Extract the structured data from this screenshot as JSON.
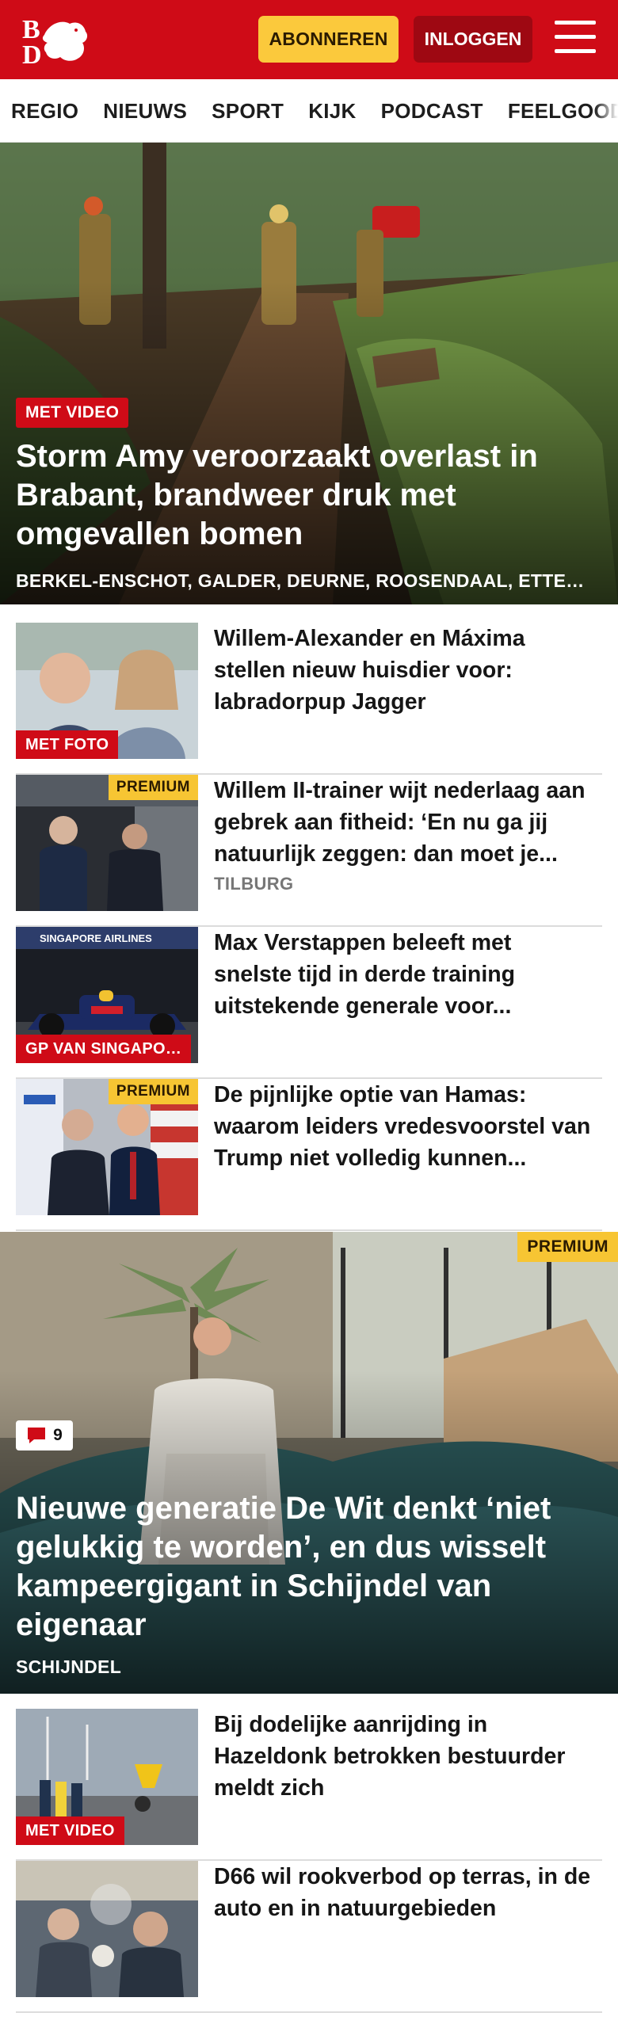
{
  "header": {
    "logo_text": "BD",
    "subscribe_label": "ABONNEREN",
    "login_label": "INLOGGEN",
    "brand_color": "#cf0b17"
  },
  "nav": {
    "items": [
      "REGIO",
      "NIEUWS",
      "SPORT",
      "KIJK",
      "PODCAST",
      "FEELGOOD"
    ]
  },
  "hero": {
    "label": "MET VIDEO",
    "title": "Storm Amy veroorzaakt overlast in Brabant, brandweer druk met omgevallen bomen",
    "places": "BERKEL-ENSCHOT, GALDER, DEURNE, ROOSENDAAL, ETTE…"
  },
  "articles_top": [
    {
      "title": "Willem-Alexander en Máxima stellen nieuw huisdier voor: labradorpup Jagger",
      "label": "MET FOTO",
      "premium": "",
      "place": ""
    },
    {
      "title": "Willem II-trainer wijt nederlaag aan gebrek aan fitheid: ‘En nu ga jij natuurlijk zeggen: dan moet je...",
      "label": "",
      "premium": "PREMIUM",
      "place": "TILBURG"
    },
    {
      "title": "Max Verstappen beleeft met snelste tijd in derde training uitstekende generale voor...",
      "label": "GP VAN SINGAPO…",
      "premium": "",
      "place": ""
    },
    {
      "title": "De pijnlijke optie van Hamas: waarom leiders vredesvoorstel van Trump niet volledig kunnen...",
      "label": "",
      "premium": "PREMIUM",
      "place": ""
    }
  ],
  "feature": {
    "premium": "PREMIUM",
    "comments": "9",
    "title": "Nieuwe generatie De Wit denkt ‘niet gelukkig te worden’, en dus wisselt kampeergigant in Schijndel van eigenaar",
    "place": "SCHIJNDEL"
  },
  "articles_bottom": [
    {
      "title": "Bij dodelijke aanrijding in Hazeldonk betrokken bestuurder meldt zich",
      "label": "MET VIDEO",
      "premium": "",
      "place": ""
    },
    {
      "title": "D66 wil rookverbod op terras, in de auto en in natuurgebieden",
      "label": "",
      "premium": "",
      "place": ""
    }
  ],
  "colors": {
    "accent_red": "#cf0b17",
    "premium_yellow": "#f7c533",
    "login_dark_red": "#9e0812"
  }
}
